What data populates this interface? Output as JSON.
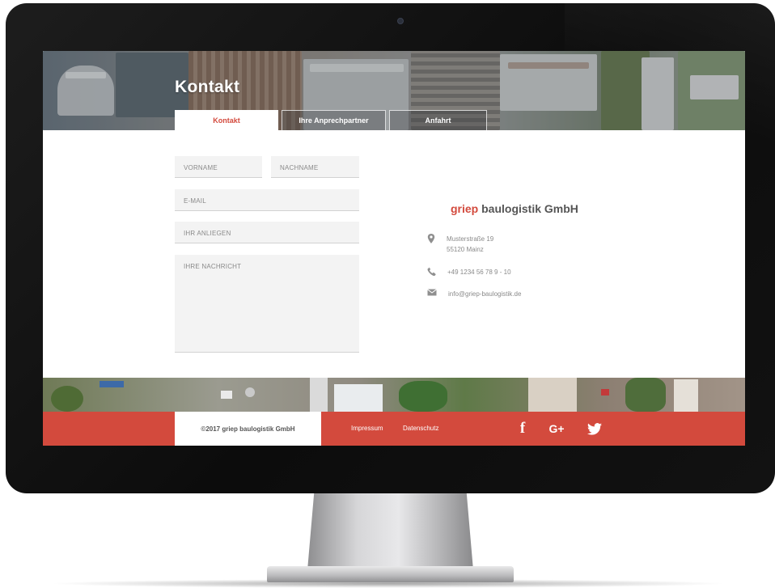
{
  "page": {
    "title": "Kontakt"
  },
  "tabs": [
    {
      "label": "Kontakt",
      "active": true
    },
    {
      "label": "Ihre Anprechpartner",
      "active": false
    },
    {
      "label": "Anfahrt",
      "active": false
    }
  ],
  "form": {
    "firstname_placeholder": "VORNAME",
    "lastname_placeholder": "NACHNAME",
    "email_placeholder": "E-MAIL",
    "subject_placeholder": "IHR ANLIEGEN",
    "message_placeholder": "IHRE NACHRICHT"
  },
  "company": {
    "brand": "griep",
    "rest": " baulogistik GmbH",
    "address_line1": "Musterstraße 19",
    "address_line2": "55120 Mainz",
    "phone": "+49 1234 56 78 9 - 10",
    "email": "info@griep-baulogistik.de"
  },
  "footer": {
    "copyright": "©2017 griep baulogistik GmbH",
    "impressum": "Impressum",
    "datenschutz": "Datenschutz",
    "social": [
      {
        "icon": "facebook-icon",
        "glyph": "f"
      },
      {
        "icon": "google-plus-icon",
        "glyph": "G+"
      },
      {
        "icon": "twitter-icon",
        "glyph": "twitter"
      }
    ]
  },
  "colors": {
    "accent": "#d34a3d",
    "bezel": "#111111",
    "field_bg": "#f3f3f3"
  }
}
